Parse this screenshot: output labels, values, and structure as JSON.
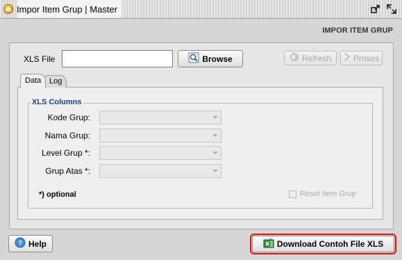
{
  "window": {
    "title": "Impor Item Grup | Master"
  },
  "page": {
    "heading": "IMPOR ITEM GRUP"
  },
  "file_row": {
    "label": "XLS File",
    "value": "",
    "browse_label": "Browse",
    "refresh_label": "Refresh",
    "proses_label": "Proses"
  },
  "tabs": [
    {
      "label": "Data",
      "active": true
    },
    {
      "label": "Log",
      "active": false
    }
  ],
  "xls_columns": {
    "legend": "XLS Columns",
    "fields": [
      {
        "label": "Kode Grup:",
        "value": ""
      },
      {
        "label": "Nama Grup:",
        "value": ""
      },
      {
        "label": "Level Grup *:",
        "value": ""
      },
      {
        "label": "Grup Atas *:",
        "value": ""
      }
    ],
    "optional_note": "*) optional",
    "reset_label": "Reset Item Grup",
    "reset_checked": false
  },
  "footer": {
    "help_label": "Help",
    "download_label": "Download Contoh File XLS"
  },
  "colors": {
    "highlight_border": "#e01010",
    "legend_text": "#203c8c",
    "disabled_text": "#a9a9a9"
  },
  "icons": {
    "app": "app-chevron-icon",
    "restore": "restore-icon",
    "maximize": "maximize-icon",
    "browse": "magnifier-icon",
    "refresh": "refresh-icon",
    "proses": "chevron-right-icon",
    "help": "help-icon",
    "download": "excel-download-icon"
  }
}
